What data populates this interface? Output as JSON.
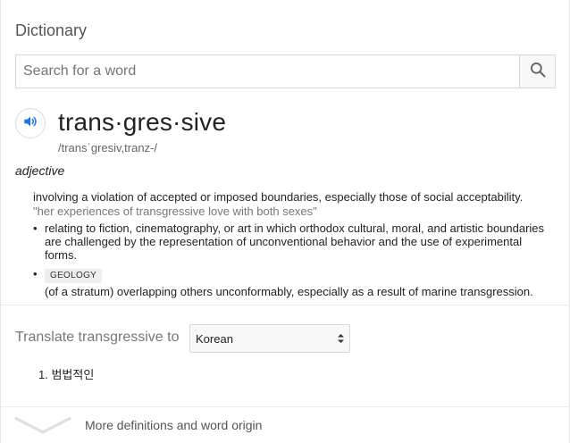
{
  "header": {
    "title": "Dictionary"
  },
  "search": {
    "placeholder": "Search for a word",
    "button_icon": "search-icon"
  },
  "entry": {
    "speaker_icon": "speaker-icon",
    "headword": "trans·gres·sive",
    "phonetic": "/transˈɡresiv,tranz-/",
    "part_of_speech": "adjective",
    "definition": "involving a violation of accepted or imposed boundaries, especially those of social acceptability.",
    "example": "\"her experiences of transgressive love with both sexes\"",
    "sub_senses": [
      {
        "bullet": "•",
        "text": "relating to fiction, cinematography, or art in which orthodox cultural, moral, and artistic boundaries are challenged by the representation of unconventional behavior and the use of experimental forms."
      },
      {
        "bullet": "•",
        "tag": "GEOLOGY",
        "text": "(of a stratum) overlapping others unconformably, especially as a result of marine transgression."
      }
    ]
  },
  "translate": {
    "label": "Translate transgressive to",
    "selected_language": "Korean",
    "results": [
      "1. 범법적인"
    ]
  },
  "footer": {
    "more_label": "More definitions and word origin",
    "chevron_icon": "chevron-down-icon"
  },
  "colors": {
    "accent_blue": "#1a73e8",
    "divider": "#ebebeb"
  }
}
